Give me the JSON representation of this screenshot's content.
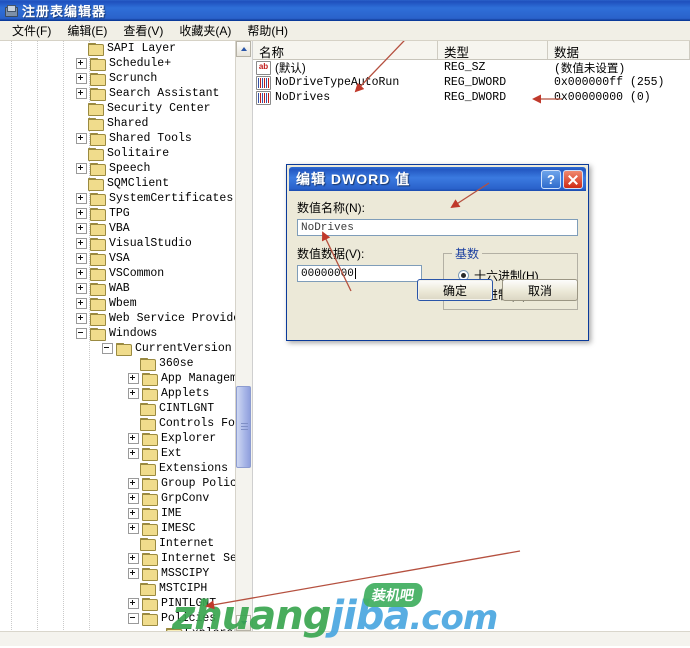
{
  "window": {
    "title": "注册表编辑器",
    "icon": "registry-editor-icon"
  },
  "menubar": [
    {
      "label": "文件(F)"
    },
    {
      "label": "编辑(E)"
    },
    {
      "label": "查看(V)"
    },
    {
      "label": "收藏夹(A)"
    },
    {
      "label": "帮助(H)"
    }
  ],
  "tree": {
    "items": [
      {
        "label": "SAPI Layer",
        "indent": 0,
        "expander": "none",
        "selected": false
      },
      {
        "label": "Schedule+",
        "indent": 0,
        "expander": "plus",
        "selected": false
      },
      {
        "label": "Scrunch",
        "indent": 0,
        "expander": "plus",
        "selected": false
      },
      {
        "label": "Search Assistant",
        "indent": 0,
        "expander": "plus",
        "selected": false
      },
      {
        "label": "Security Center",
        "indent": 0,
        "expander": "none",
        "selected": false
      },
      {
        "label": "Shared",
        "indent": 0,
        "expander": "none",
        "selected": false
      },
      {
        "label": "Shared Tools",
        "indent": 0,
        "expander": "plus",
        "selected": false
      },
      {
        "label": "Solitaire",
        "indent": 0,
        "expander": "none",
        "selected": false
      },
      {
        "label": "Speech",
        "indent": 0,
        "expander": "plus",
        "selected": false
      },
      {
        "label": "SQMClient",
        "indent": 0,
        "expander": "none",
        "selected": false
      },
      {
        "label": "SystemCertificates",
        "indent": 0,
        "expander": "plus",
        "selected": false
      },
      {
        "label": "TPG",
        "indent": 0,
        "expander": "plus",
        "selected": false
      },
      {
        "label": "VBA",
        "indent": 0,
        "expander": "plus",
        "selected": false
      },
      {
        "label": "VisualStudio",
        "indent": 0,
        "expander": "plus",
        "selected": false
      },
      {
        "label": "VSA",
        "indent": 0,
        "expander": "plus",
        "selected": false
      },
      {
        "label": "VSCommon",
        "indent": 0,
        "expander": "plus",
        "selected": false
      },
      {
        "label": "WAB",
        "indent": 0,
        "expander": "plus",
        "selected": false
      },
      {
        "label": "Wbem",
        "indent": 0,
        "expander": "plus",
        "selected": false
      },
      {
        "label": "Web Service Providers",
        "indent": 0,
        "expander": "plus",
        "selected": false
      },
      {
        "label": "Windows",
        "indent": 0,
        "expander": "minus",
        "selected": false
      },
      {
        "label": "CurrentVersion",
        "indent": 1,
        "expander": "minus",
        "selected": false
      },
      {
        "label": "360se",
        "indent": 2,
        "expander": "none",
        "selected": false
      },
      {
        "label": "App Management",
        "indent": 2,
        "expander": "plus",
        "selected": false
      },
      {
        "label": "Applets",
        "indent": 2,
        "expander": "plus",
        "selected": false
      },
      {
        "label": "CINTLGNT",
        "indent": 2,
        "expander": "none",
        "selected": false
      },
      {
        "label": "Controls Folder",
        "indent": 2,
        "expander": "none",
        "selected": false
      },
      {
        "label": "Explorer",
        "indent": 2,
        "expander": "plus",
        "selected": false
      },
      {
        "label": "Ext",
        "indent": 2,
        "expander": "plus",
        "selected": false
      },
      {
        "label": "Extensions",
        "indent": 2,
        "expander": "none",
        "selected": false
      },
      {
        "label": "Group Policy",
        "indent": 2,
        "expander": "plus",
        "selected": false
      },
      {
        "label": "GrpConv",
        "indent": 2,
        "expander": "plus",
        "selected": false
      },
      {
        "label": "IME",
        "indent": 2,
        "expander": "plus",
        "selected": false
      },
      {
        "label": "IMESC",
        "indent": 2,
        "expander": "plus",
        "selected": false
      },
      {
        "label": "Internet",
        "indent": 2,
        "expander": "none",
        "selected": false
      },
      {
        "label": "Internet Setting",
        "indent": 2,
        "expander": "plus",
        "selected": false
      },
      {
        "label": "MSSCIPY",
        "indent": 2,
        "expander": "plus",
        "selected": false
      },
      {
        "label": "MSTCIPH",
        "indent": 2,
        "expander": "none",
        "selected": false
      },
      {
        "label": "PINTLGNT",
        "indent": 2,
        "expander": "plus",
        "selected": false
      },
      {
        "label": "Policies",
        "indent": 2,
        "expander": "minus",
        "selected": false
      },
      {
        "label": "Explorer",
        "indent": 3,
        "expander": "none",
        "selected": true
      }
    ]
  },
  "list": {
    "columns": [
      "名称",
      "类型",
      "数据"
    ],
    "rows": [
      {
        "icon": "string-value-icon",
        "name": "(默认)",
        "type": "REG_SZ",
        "data": "(数值未设置)"
      },
      {
        "icon": "binary-value-icon",
        "name": "NoDriveTypeAutoRun",
        "type": "REG_DWORD",
        "data": "0x000000ff  (255)"
      },
      {
        "icon": "binary-value-icon",
        "name": "NoDrives",
        "type": "REG_DWORD",
        "data": "0x00000000  (0)"
      }
    ]
  },
  "dialog": {
    "title": "编辑 DWORD 值",
    "help_button": "?",
    "close_button": "✕",
    "name_label": "数值名称(N):",
    "name_value": "NoDrives",
    "data_label": "数值数据(V):",
    "data_value": "00000000",
    "base_group": "基数",
    "base_options": [
      {
        "label": "十六进制(H)",
        "selected": true
      },
      {
        "label": "十进制(D)",
        "selected": false
      }
    ],
    "ok_button": "确定",
    "cancel_button": "取消"
  },
  "watermark": {
    "text_green": "zhuang",
    "text_blue": "jiba",
    "text_dot": ".com",
    "badge": "装机吧"
  },
  "colors": {
    "title_blue": "#2a62cb",
    "dialog_face": "#ece9d8",
    "folder_yellow": "#f0dc8c",
    "annotation_red": "#c0392b",
    "watermark_green": "#3aa650",
    "watermark_blue": "#4aa7e0"
  }
}
